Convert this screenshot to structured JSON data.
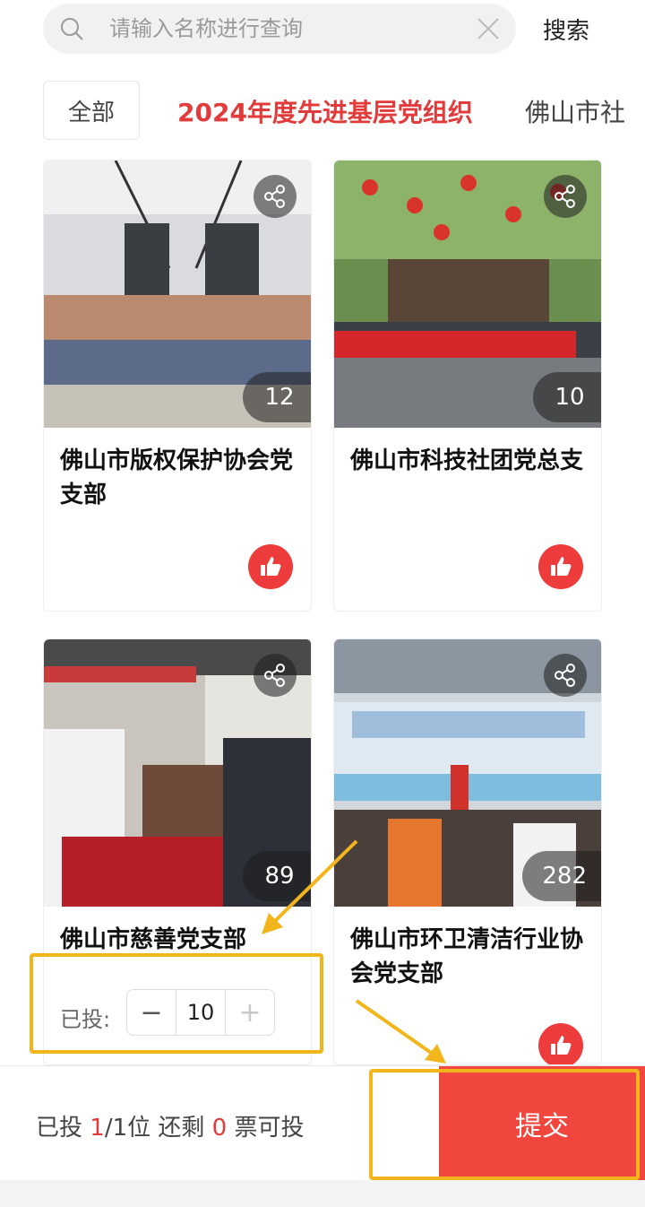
{
  "search": {
    "placeholder": "请输入名称进行查询",
    "button_label": "搜索"
  },
  "tabs": {
    "all": "全部",
    "active": "2024年度先进基层党组织",
    "next": "佛山市社"
  },
  "cards": [
    {
      "title": "佛山市版权保护协会党支部",
      "count": "12"
    },
    {
      "title": "佛山市科技社团党总支",
      "count": "10"
    },
    {
      "title": "佛山市慈善党支部",
      "count": "89",
      "voted_label": "已投:",
      "stepper": {
        "minus": "−",
        "value": "10",
        "plus": "+"
      }
    },
    {
      "title": "佛山市环卫清洁行业协会党支部",
      "count": "282"
    }
  ],
  "bottom_bar": {
    "voted_prefix": "已投 ",
    "voted_num": "1",
    "voted_mid": "/1位 还剩 ",
    "remaining_num": "0",
    "voted_suffix": " 票可投",
    "submit_label": "提交"
  },
  "colors": {
    "accent_red": "#f0463d",
    "annotation_yellow": "#f2b61c"
  }
}
